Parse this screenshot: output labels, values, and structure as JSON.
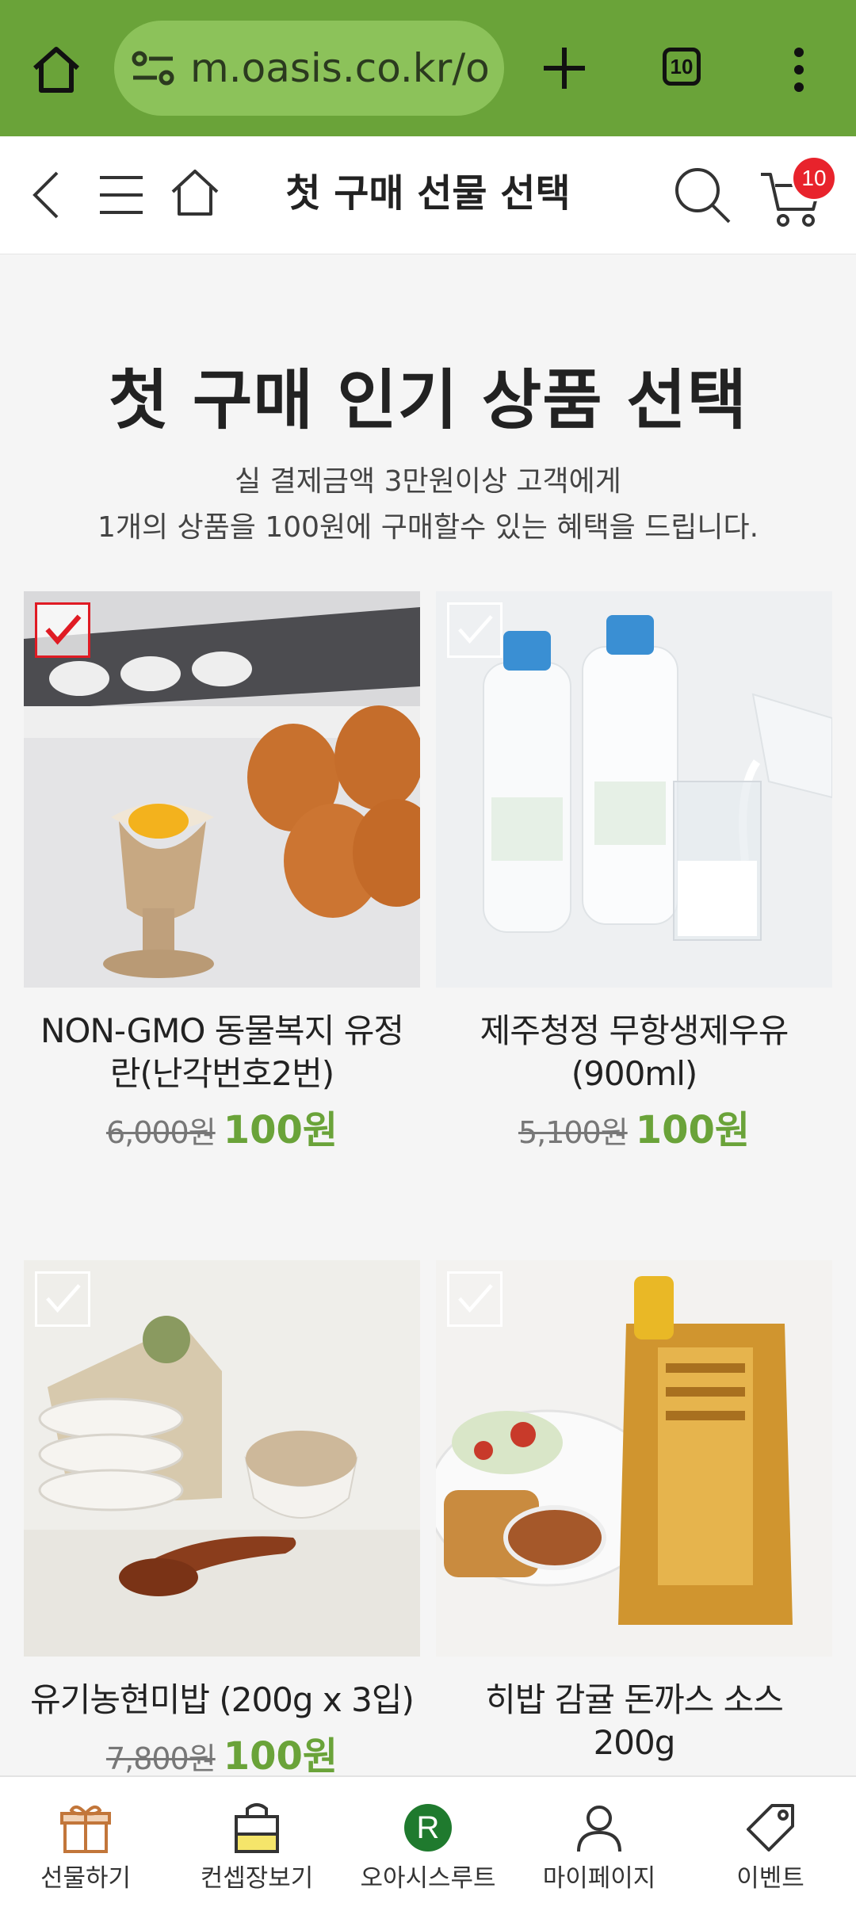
{
  "browser": {
    "url": "m.oasis.co.kr/o",
    "tab_count": "10"
  },
  "header": {
    "title": "첫 구매 선물 선택",
    "cart_count": "10"
  },
  "promo": {
    "headline": "첫 구매 인기 상품 선택",
    "subtitle_line1": "실 결제금액 3만원이상 고객에게",
    "subtitle_line2": "1개의 상품을 100원에 구매할수 있는 혜택을 드립니다."
  },
  "products": [
    {
      "name_line1": "NON-GMO 동물복지 유정",
      "name_line2": "란(난각번호2번)",
      "original_price": "6,000원",
      "sale_price": "100원",
      "selected": true
    },
    {
      "name_line1": "제주청정 무항생제우유",
      "name_line2": "(900ml)",
      "original_price": "5,100원",
      "sale_price": "100원",
      "selected": false
    },
    {
      "name_line1": "유기농현미밥 (200g x 3입)",
      "name_line2": "",
      "original_price": "7,800원",
      "sale_price": "100원",
      "selected": false
    },
    {
      "name_line1": "히밥 감귤 돈까스 소스",
      "name_line2": "200g",
      "original_price": "",
      "sale_price": "",
      "selected": false
    }
  ],
  "bottom_nav": [
    {
      "label": "선물하기",
      "icon": "gift-icon"
    },
    {
      "label": "컨셉장보기",
      "icon": "shopping-bag-icon"
    },
    {
      "label": "오아시스루트",
      "icon": "oasis-route-icon",
      "icon_letter": "R"
    },
    {
      "label": "마이페이지",
      "icon": "user-icon"
    },
    {
      "label": "이벤트",
      "icon": "tag-icon"
    }
  ],
  "colors": {
    "browser_bar": "#6aa339",
    "accent_green": "#6aa339",
    "badge_red": "#e8232c",
    "check_red": "#e01b24"
  }
}
